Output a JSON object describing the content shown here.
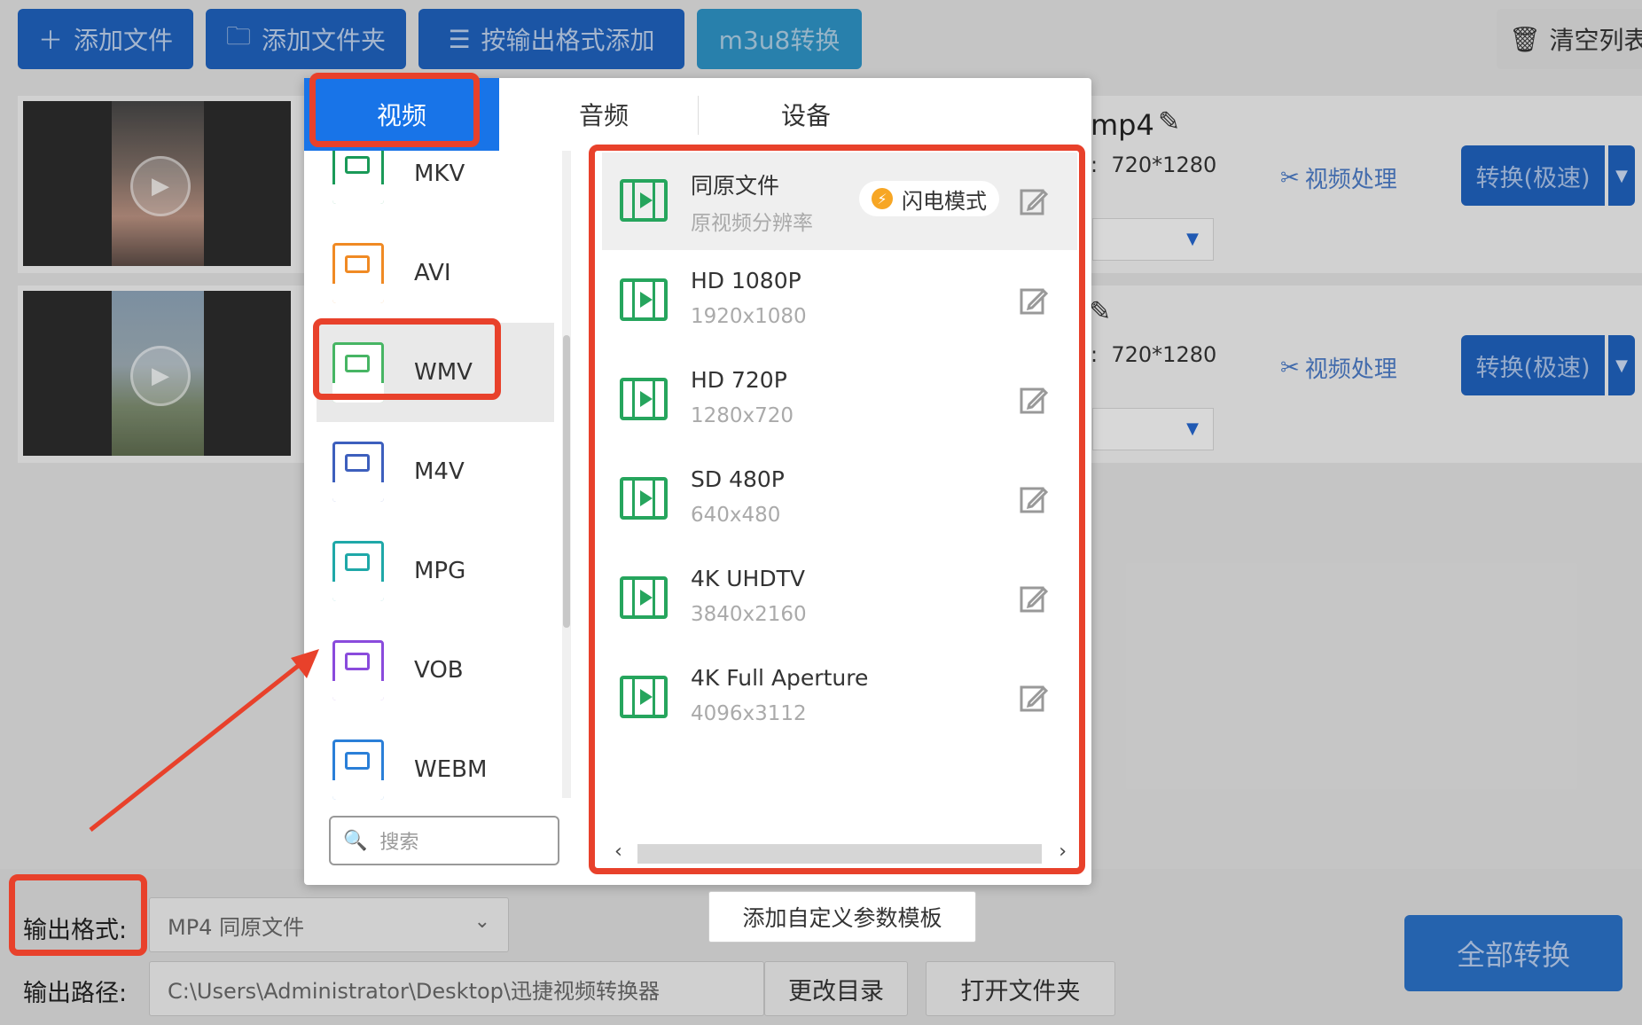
{
  "toolbar": {
    "add_file": "添加文件",
    "add_folder": "添加文件夹",
    "add_by_format": "按输出格式添加",
    "m3u8": "m3u8转换",
    "clear_list": "清空列表"
  },
  "rows": [
    {
      "ext": "mp4",
      "res_label_tail": ":",
      "res": "720*1280",
      "process": "视频处理",
      "convert": "转换(极速)"
    },
    {
      "ext": "",
      "res_label_tail": ":",
      "res": "720*1280",
      "process": "视频处理",
      "convert": "转换(极速)"
    }
  ],
  "popup": {
    "tabs": [
      "视频",
      "音频",
      "设备"
    ],
    "formats": [
      {
        "name": "MKV",
        "badge": "MKV",
        "color": "#1a9a58"
      },
      {
        "name": "AVI",
        "badge": "AVI",
        "color": "#f08a24"
      },
      {
        "name": "WMV",
        "badge": "WMV",
        "color": "#47b564"
      },
      {
        "name": "M4V",
        "badge": "M4V",
        "color": "#3d5fbd"
      },
      {
        "name": "MPG",
        "badge": "MPG",
        "color": "#1fa8a8"
      },
      {
        "name": "VOB",
        "badge": "VOB",
        "color": "#8a4bdc"
      },
      {
        "name": "WEBM",
        "badge": "WEBM",
        "color": "#2a7fd8"
      }
    ],
    "search_placeholder": "搜索",
    "resolutions": [
      {
        "name": "同原文件",
        "size": "原视频分辨率"
      },
      {
        "name": "HD 1080P",
        "size": "1920x1080"
      },
      {
        "name": "HD 720P",
        "size": "1280x720"
      },
      {
        "name": "SD 480P",
        "size": "640x480"
      },
      {
        "name": "4K UHDTV",
        "size": "3840x2160"
      },
      {
        "name": "4K Full Aperture",
        "size": "4096x3112"
      }
    ],
    "flash_mode": "闪电模式",
    "add_template": "添加自定义参数模板"
  },
  "bottom": {
    "output_format_label": "输出格式:",
    "output_format_value": "MP4  同原文件",
    "output_path_label": "输出路径:",
    "output_path_value": "C:\\Users\\Administrator\\Desktop\\迅捷视频转换器",
    "change_dir": "更改目录",
    "open_folder": "打开文件夹",
    "convert_all": "全部转换"
  },
  "colors": {
    "accent": "#1874e8",
    "annotation": "#e8412b",
    "icon_green": "#26a55d"
  }
}
